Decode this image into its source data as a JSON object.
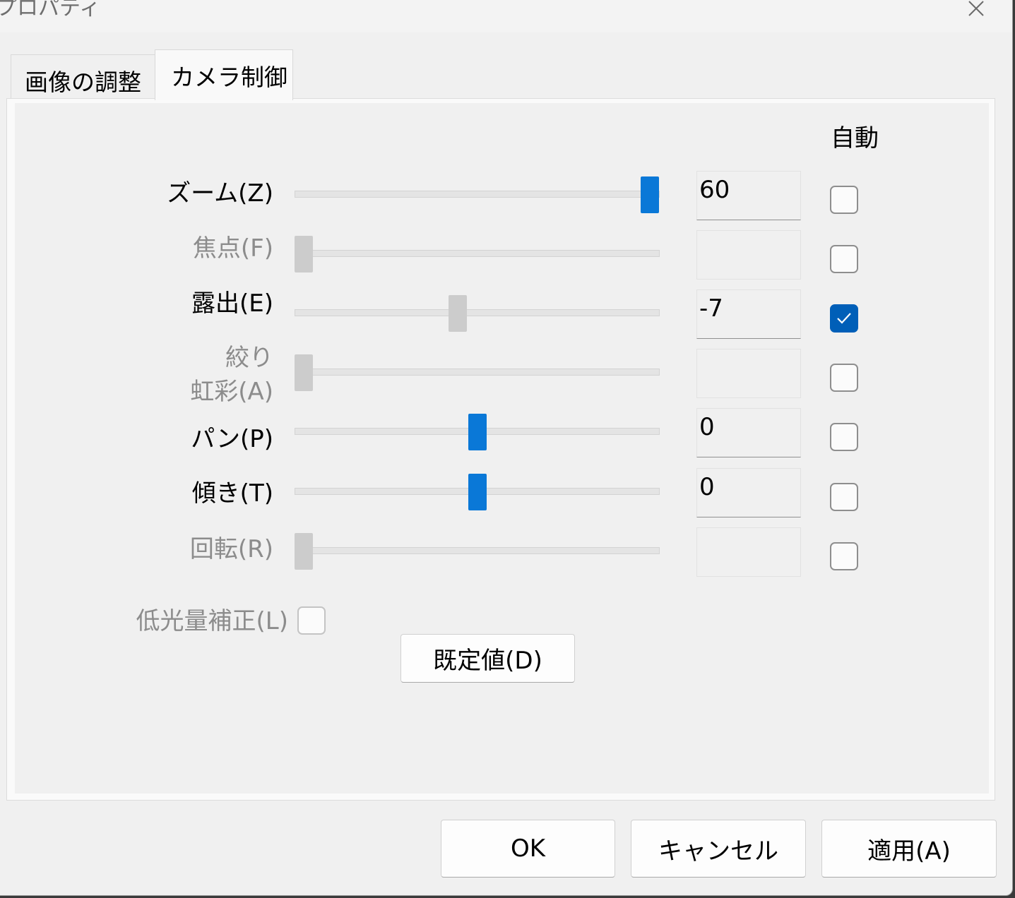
{
  "window": {
    "title": "プロパティ"
  },
  "tabs": [
    {
      "label": "画像の調整",
      "selected": false
    },
    {
      "label": "カメラ制御",
      "selected": true
    }
  ],
  "auto_header": "自動",
  "controls": [
    {
      "label": "ズーム(Z)",
      "value": "60",
      "slider_fraction": 1.0,
      "enabled": true,
      "auto": false
    },
    {
      "label": "焦点(F)",
      "value": "",
      "slider_fraction": 0.0,
      "enabled": false,
      "auto": false
    },
    {
      "label": "露出(E)",
      "value": "-7",
      "slider_fraction": 0.47,
      "enabled": true,
      "auto": true
    },
    {
      "label_line1": "絞り",
      "label_line2": "虹彩(A)",
      "value": "",
      "slider_fraction": 0.0,
      "enabled": false,
      "auto": false
    },
    {
      "label": "パン(P)",
      "value": "0",
      "slider_fraction": 0.5,
      "enabled": true,
      "auto": false
    },
    {
      "label": "傾き(T)",
      "value": "0",
      "slider_fraction": 0.5,
      "enabled": true,
      "auto": false
    },
    {
      "label": "回転(R)",
      "value": "",
      "slider_fraction": 0.0,
      "enabled": false,
      "auto": false
    }
  ],
  "low_light": {
    "label": "低光量補正(L)",
    "checked": false,
    "enabled": false
  },
  "buttons": {
    "default": "既定値(D)",
    "ok": "OK",
    "cancel": "キャンセル",
    "apply": "適用(A)"
  },
  "colors": {
    "accent": "#0a78d7",
    "checkbox_checked": "#005fb8",
    "disabled_text": "#8c8c8c"
  }
}
